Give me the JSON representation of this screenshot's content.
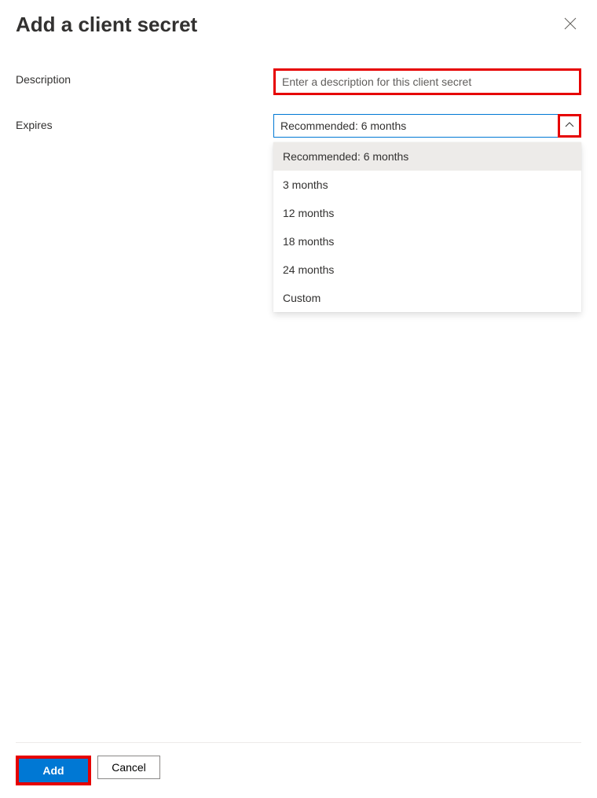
{
  "header": {
    "title": "Add a client secret"
  },
  "form": {
    "description": {
      "label": "Description",
      "placeholder": "Enter a description for this client secret",
      "value": ""
    },
    "expires": {
      "label": "Expires",
      "selected": "Recommended: 6 months",
      "options": [
        "Recommended: 6 months",
        "3 months",
        "12 months",
        "18 months",
        "24 months",
        "Custom"
      ]
    }
  },
  "footer": {
    "add_label": "Add",
    "cancel_label": "Cancel"
  }
}
